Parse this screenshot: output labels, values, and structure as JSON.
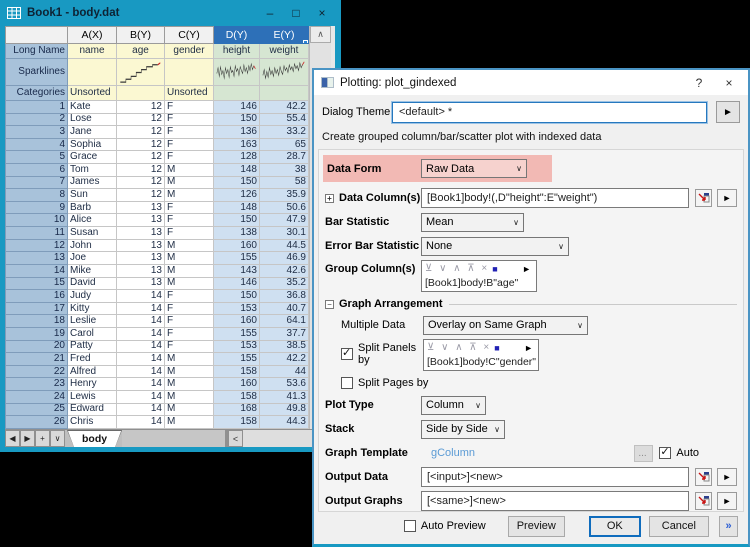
{
  "colors": {
    "accent_teal": "#1899c2",
    "selected_header_blue": "#2d70b8",
    "selected_cell_blue": "#cfe0f1",
    "label_yellow": "#fbf8d2",
    "selected_label_green": "#d6e6d2",
    "highlight_pink": "#f2b9b4",
    "link_blue": "#5b9bd5",
    "ok_border_blue": "#0f6cbd"
  },
  "worksheet": {
    "title": "Book1 - body.dat",
    "window_controls": {
      "minimize": "–",
      "maximize": "□",
      "close": "×"
    },
    "column_headers": [
      "A(X)",
      "B(Y)",
      "C(Y)",
      "D(Y)",
      "E(Y)"
    ],
    "row_labels": {
      "long_name": "Long Name",
      "sparklines": "Sparklines",
      "categories": "Categories"
    },
    "long_names": [
      "name",
      "age",
      "gender",
      "height",
      "weight"
    ],
    "categories": {
      "name": "Unsorted",
      "gender": "Unsorted"
    },
    "sparklines": {
      "age": "3,23 16,23 16,20 28,20 28,17 40,17 40,13 52,13 52,10 64,10 64,7 78,7 78,5 90,5",
      "age_end": "90,5 96,3",
      "height": "2,14 5,8 8,17 11,7 14,15 17,11 20,19 23,8 26,14 29,10 32,18 35,7 38,13 41,11 44,17 47,6 50,12 53,9 56,16 59,7 62,11 65,14 68,5 71,12 74,8 77,14 80,6 83,11 86,4 89,10 92,6",
      "height_end": "92,6 96,9",
      "weight": "2,16 5,10 8,19 11,12 14,18 17,8 20,15 23,11 26,17 29,8 32,14 35,10 38,16 41,7 44,12 47,15 50,6 53,11 56,8 59,13 62,5 65,10 68,7 71,12 74,4 77,9 80,6 83,11 86,3 89,8 92,5",
      "weight_end": "92,5 96,2"
    },
    "rows": [
      [
        1,
        "Kate",
        12,
        "F",
        146,
        42.2
      ],
      [
        2,
        "Lose",
        12,
        "F",
        150,
        55.4
      ],
      [
        3,
        "Jane",
        12,
        "F",
        136,
        33.2
      ],
      [
        4,
        "Sophia",
        12,
        "F",
        163,
        65
      ],
      [
        5,
        "Grace",
        12,
        "F",
        128,
        28.7
      ],
      [
        6,
        "Tom",
        12,
        "M",
        148,
        38
      ],
      [
        7,
        "James",
        12,
        "M",
        150,
        58
      ],
      [
        8,
        "Sun",
        12,
        "M",
        126,
        35.9
      ],
      [
        9,
        "Barb",
        13,
        "F",
        148,
        50.6
      ],
      [
        10,
        "Alice",
        13,
        "F",
        150,
        47.9
      ],
      [
        11,
        "Susan",
        13,
        "F",
        138,
        30.1
      ],
      [
        12,
        "John",
        13,
        "M",
        160,
        44.5
      ],
      [
        13,
        "Joe",
        13,
        "M",
        155,
        46.9
      ],
      [
        14,
        "Mike",
        13,
        "M",
        143,
        42.6
      ],
      [
        15,
        "David",
        13,
        "M",
        146,
        35.2
      ],
      [
        16,
        "Judy",
        14,
        "F",
        150,
        36.8
      ],
      [
        17,
        "Kitty",
        14,
        "F",
        153,
        40.7
      ],
      [
        18,
        "Leslie",
        14,
        "F",
        160,
        64.1
      ],
      [
        19,
        "Carol",
        14,
        "F",
        155,
        37.7
      ],
      [
        20,
        "Patty",
        14,
        "F",
        153,
        38.5
      ],
      [
        21,
        "Fred",
        14,
        "M",
        155,
        42.2
      ],
      [
        22,
        "Alfred",
        14,
        "M",
        158,
        44
      ],
      [
        23,
        "Henry",
        14,
        "M",
        160,
        53.6
      ],
      [
        24,
        "Lewis",
        14,
        "M",
        158,
        41.3
      ],
      [
        25,
        "Edward",
        14,
        "M",
        168,
        49.8
      ],
      [
        26,
        "Chris",
        14,
        "M",
        158,
        44.3
      ]
    ],
    "nav": [
      "◀",
      "▶",
      "+",
      "∨"
    ],
    "sheet_tab": "body",
    "vscroll_up": "∧",
    "hscroll_left": "<"
  },
  "dialog": {
    "title": "Plotting: plot_gindexed",
    "help": "?",
    "close": "×",
    "theme": {
      "label": "Dialog Theme",
      "value": "<default> *",
      "menu": "►"
    },
    "description": "Create grouped column/bar/scatter plot with indexed data",
    "listbox_toolbar": {
      "arrows": "⊻ ∨ ∧ ⊼ ×",
      "swatch": "■",
      "menu": "►"
    },
    "fields": {
      "data_form": {
        "label": "Data Form",
        "value": "Raw Data"
      },
      "data_columns": {
        "label": "Data Column(s)",
        "expand": "+",
        "value": "[Book1]body!(,D\"height\":E\"weight\")",
        "menu": "►"
      },
      "bar_statistic": {
        "label": "Bar Statistic",
        "value": "Mean"
      },
      "error_bar_statistic": {
        "label": "Error Bar Statistic",
        "value": "None"
      },
      "group_columns": {
        "label": "Group Column(s)",
        "value": "[Book1]body!B\"age\""
      },
      "graph_arrangement": {
        "label": "Graph Arrangement",
        "collapse": "−"
      },
      "multiple_data": {
        "label": "Multiple Data",
        "value": "Overlay on Same Graph"
      },
      "split_panels": {
        "label": "Split Panels by",
        "value": "[Book1]body!C\"gender\""
      },
      "split_pages": {
        "label": "Split Pages by"
      },
      "plot_type": {
        "label": "Plot Type",
        "value": "Column"
      },
      "stack": {
        "label": "Stack",
        "value": "Side by Side"
      },
      "graph_template": {
        "label": "Graph Template",
        "value": "gColumn",
        "more": "...",
        "auto_label": "Auto"
      },
      "output_data": {
        "label": "Output Data",
        "value": "[<input>]<new>",
        "menu": "►"
      },
      "output_graphs": {
        "label": "Output Graphs",
        "value": "[<same>]<new>",
        "menu": "►"
      }
    },
    "chevron": "∨",
    "buttons": {
      "auto_preview": "Auto Preview",
      "preview": "Preview",
      "ok": "OK",
      "cancel": "Cancel",
      "more": "»"
    }
  }
}
